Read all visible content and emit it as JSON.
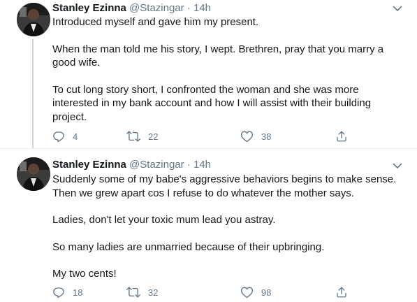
{
  "tweets": [
    {
      "author_name": "Stanley Ezinna",
      "handle": "@Stazingar",
      "separator": "·",
      "time": "14h",
      "paragraphs": [
        "Introduced myself and gave him my present.",
        "When the man told me his story, I wept. Brethren, pray that you marry a good wife.",
        "To cut long story short, I confronted the woman and she was more interested in my bank account and how I will assist with their building project."
      ],
      "replies": "4",
      "retweets": "22",
      "likes": "38"
    },
    {
      "author_name": "Stanley Ezinna",
      "handle": "@Stazingar",
      "separator": "·",
      "time": "14h",
      "paragraphs": [
        "Suddenly some of my babe's aggressive behaviors begins to make sense. Then we grew apart cos I refuse to do whatever the mother says.",
        "Ladies, don't let your toxic mum lead you astray.",
        "So many ladies are unmarried because of their upbringing.",
        "My two cents!"
      ],
      "replies": "18",
      "retweets": "32",
      "likes": "98"
    }
  ],
  "icons": {
    "reply": "reply-icon",
    "retweet": "retweet-icon",
    "like": "heart-icon",
    "share": "share-icon",
    "menu": "chevron-down-icon"
  },
  "colors": {
    "text": "#14171a",
    "secondary": "#657786",
    "thread_line": "#ccd6dd",
    "divider": "#e6ecf0"
  }
}
